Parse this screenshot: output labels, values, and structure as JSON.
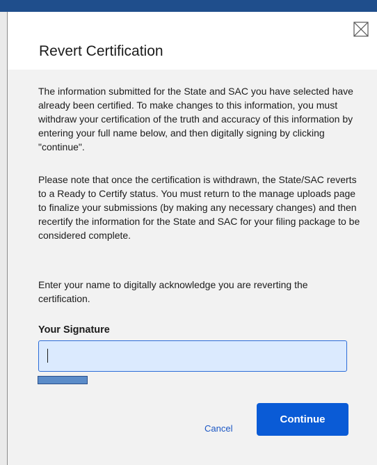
{
  "dialog": {
    "title": "Revert Certification",
    "close_icon": "close-icon"
  },
  "body": {
    "paragraph_1": "The information submitted for the State and SAC you have selected have already been certified. To make changes to this information, you must withdraw your certification of the truth and accuracy of this information by entering your full name below, and then digitally signing by clicking \"continue\".",
    "paragraph_2": "Please note that once the certification is withdrawn, the State/SAC reverts to a Ready to Certify status. You must return to the manage uploads page to finalize your submissions (by making any necessary changes) and then recertify the information for the State and SAC for your filing package to be considered complete.",
    "paragraph_3": "Enter your name to digitally acknowledge you are reverting the certification."
  },
  "signature": {
    "label": "Your Signature",
    "value": ""
  },
  "actions": {
    "cancel_label": "Cancel",
    "continue_label": "Continue"
  },
  "colors": {
    "header_bar": "#1f4e8c",
    "primary_button": "#0a5bd6",
    "link": "#1a56c4",
    "input_background": "#dbeafe"
  }
}
